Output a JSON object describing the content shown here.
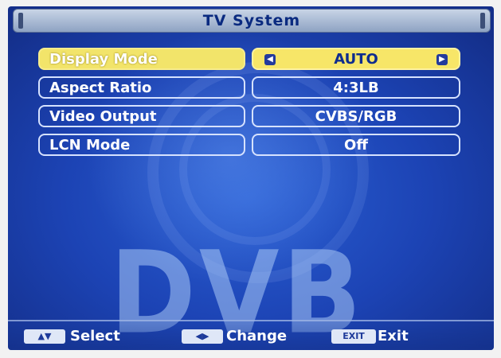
{
  "title": "TV System",
  "watermark": "DVB",
  "menu": [
    {
      "label": "Display Mode",
      "value": "AUTO",
      "active": true
    },
    {
      "label": "Aspect Ratio",
      "value": "4:3LB",
      "active": false
    },
    {
      "label": "Video Output",
      "value": "CVBS/RGB",
      "active": false
    },
    {
      "label": "LCN Mode",
      "value": "Off",
      "active": false
    }
  ],
  "footer": {
    "select": {
      "key_icon": "up-down-arrows",
      "label": "Select"
    },
    "change": {
      "key_icon": "left-right-arrows",
      "label": "Change"
    },
    "exit": {
      "key": "EXIT",
      "label": "Exit"
    }
  },
  "colors": {
    "background": "#1c43b4",
    "highlight": "#f2e46a",
    "title_bar": "#a9b8d2",
    "text": "#ffffff"
  }
}
